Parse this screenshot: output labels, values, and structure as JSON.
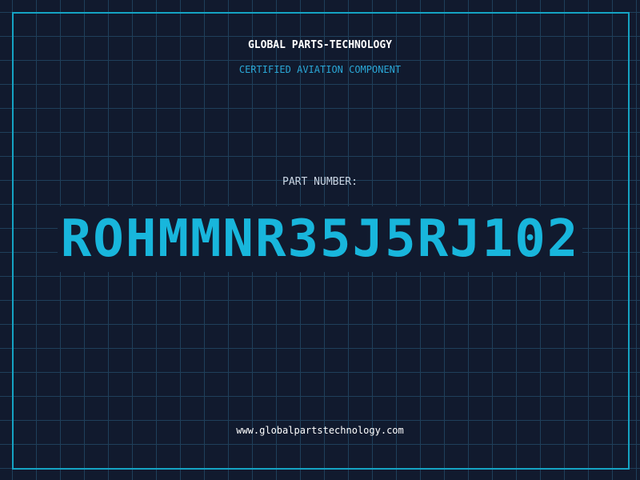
{
  "header": {
    "company_name": "GLOBAL PARTS-TECHNOLOGY",
    "tagline": "CERTIFIED AVIATION COMPONENT"
  },
  "part": {
    "label": "PART NUMBER:",
    "number": "ROHMMNR35J5RJ102"
  },
  "footer": {
    "website": "www.globalpartstechnology.com"
  },
  "colors": {
    "background": "#111a2e",
    "grid": "#1f3f5a",
    "accent": "#18b6dc",
    "frame": "#15a3c4"
  }
}
